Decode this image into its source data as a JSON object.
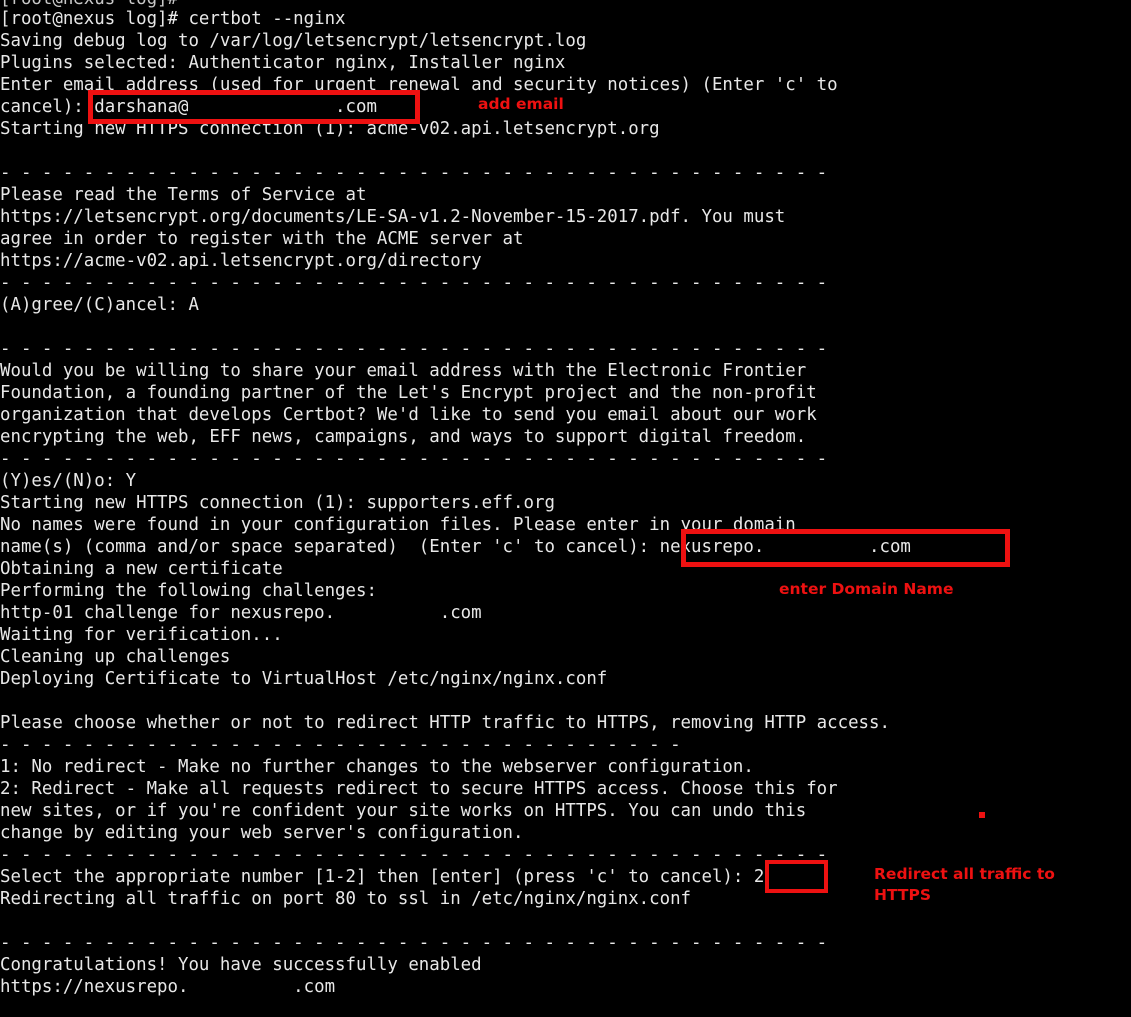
{
  "terminal": {
    "prompt_user": "root",
    "prompt_host": "nexus",
    "prompt_dir": "log",
    "background_color": "#000000",
    "text_color": "#e8e8e8",
    "annotation_color": "#ee1111",
    "lines": [
      "[root@nexus log]#",
      "[root@nexus log]# certbot --nginx",
      "Saving debug log to /var/log/letsencrypt/letsencrypt.log",
      "Plugins selected: Authenticator nginx, Installer nginx",
      "Enter email address (used for urgent renewal and security notices) (Enter 'c' to",
      "cancel): darshana@              .com",
      "Starting new HTTPS connection (1): acme-v02.api.letsencrypt.org",
      "",
      "- - - - - - - - - - - - - - - - - - - - - - - - - - - - - - - - - - - - - - - -",
      "Please read the Terms of Service at",
      "https://letsencrypt.org/documents/LE-SA-v1.2-November-15-2017.pdf. You must",
      "agree in order to register with the ACME server at",
      "https://acme-v02.api.letsencrypt.org/directory",
      "- - - - - - - - - - - - - - - - - - - - - - - - - - - - - - - - - - - - - - - -",
      "(A)gree/(C)ancel: A",
      "",
      "- - - - - - - - - - - - - - - - - - - - - - - - - - - - - - - - - - - - - - - -",
      "Would you be willing to share your email address with the Electronic Frontier",
      "Foundation, a founding partner of the Let's Encrypt project and the non-profit",
      "organization that develops Certbot? We'd like to send you email about our work",
      "encrypting the web, EFF news, campaigns, and ways to support digital freedom.",
      "- - - - - - - - - - - - - - - - - - - - - - - - - - - - - - - - - - - - - - - -",
      "(Y)es/(N)o: Y",
      "Starting new HTTPS connection (1): supporters.eff.org",
      "No names were found in your configuration files. Please enter in your domain",
      "name(s) (comma and/or space separated)  (Enter 'c' to cancel): nexusrepo.          .com",
      "Obtaining a new certificate",
      "Performing the following challenges:",
      "http-01 challenge for nexusrepo.          .com",
      "Waiting for verification...",
      "Cleaning up challenges",
      "Deploying Certificate to VirtualHost /etc/nginx/nginx.conf",
      "",
      "Please choose whether or not to redirect HTTP traffic to HTTPS, removing HTTP access.",
      "- - - - - - - - - - - - - - - - - - - - - - - - - - - - - - - - -",
      "1: No redirect - Make no further changes to the webserver configuration.",
      "2: Redirect - Make all requests redirect to secure HTTPS access. Choose this for",
      "new sites, or if you're confident your site works on HTTPS. You can undo this",
      "change by editing your web server's configuration.",
      "- - - - - - - - - - - - - - - - - - - - - - - - - - - - - - - - - - - - - - - -",
      "Select the appropriate number [1-2] then [enter] (press 'c' to cancel): 2",
      "Redirecting all traffic on port 80 to ssl in /etc/nginx/nginx.conf",
      "",
      "- - - - - - - - - - - - - - - - - - - - - - - - - - - - - - - - - - - - - - - -",
      "Congratulations! You have successfully enabled",
      "https://nexusrepo.          .com"
    ],
    "inputs": {
      "email_value": "darshana@              .com",
      "domain_value": "nexusrepo.          .com",
      "redirect_choice": "2",
      "tos_answer": "A",
      "eff_answer": "Y"
    },
    "annotations": [
      {
        "id": "add-email",
        "label": "add email"
      },
      {
        "id": "enter-domain-name",
        "label": "enter Domain Name"
      },
      {
        "id": "redirect-all-traffic",
        "label": "Redirect all traffic to\nHTTPS"
      }
    ]
  }
}
